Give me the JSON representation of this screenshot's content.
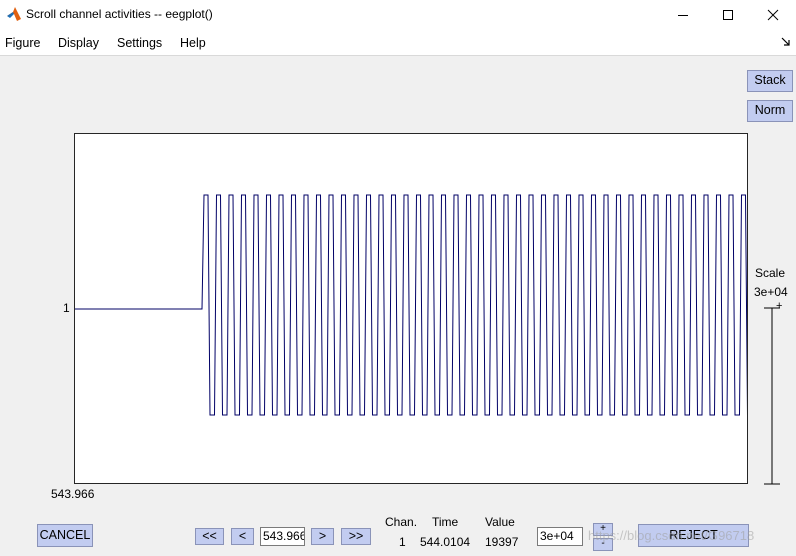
{
  "window": {
    "title": "Scroll channel activities -- eegplot()"
  },
  "menu": {
    "items": [
      "Figure",
      "Display",
      "Settings",
      "Help"
    ]
  },
  "side_buttons": {
    "stack": "Stack",
    "norm": "Norm"
  },
  "plot": {
    "channel_label": "1",
    "time_start_label": "543.966",
    "trace_color": "#000066"
  },
  "scale": {
    "label": "Scale",
    "value": "3e+04",
    "plus": "+"
  },
  "bottom": {
    "cancel": "CANCEL",
    "nav_first": "<<",
    "nav_prev": "<",
    "time_input": "543.966",
    "nav_next": ">",
    "nav_last": ">>",
    "chan_header": "Chan.",
    "time_header": "Time",
    "value_header": "Value",
    "chan_value": "1",
    "time_value": "544.0104",
    "value_value": "19397",
    "scale_input": "3e+04",
    "scale_plus": "+",
    "scale_minus": "-",
    "reject": "REJECT"
  },
  "watermark": "https://blog.csdn.net/G96718",
  "colors": {
    "button_blue": "#c2ccf0",
    "window_bg": "#f0f0f0",
    "plot_bg": "#ffffff"
  }
}
